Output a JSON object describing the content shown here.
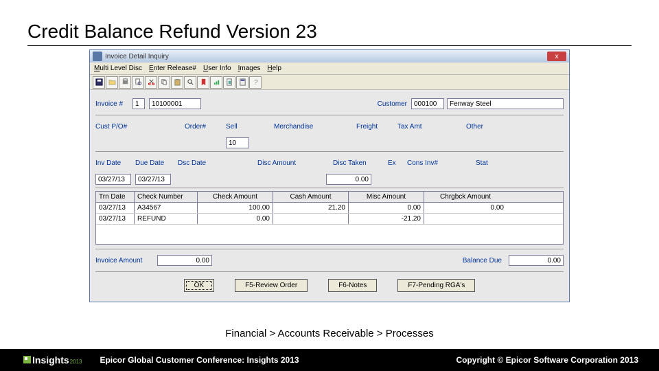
{
  "slide": {
    "title": "Credit Balance Refund Version 23"
  },
  "window": {
    "title": "Invoice Detail Inquiry",
    "close": "x"
  },
  "menu": [
    "Multi Level Disc",
    "Enter Release#",
    "User Info",
    "Images",
    "Help"
  ],
  "row1": {
    "invoice_lbl": "Invoice #",
    "seq": "1",
    "invoice": "10100001",
    "customer_lbl": "Customer",
    "customer_id": "000100",
    "customer_name": "Fenway Steel"
  },
  "row2": {
    "custpo_lbl": "Cust P/O#",
    "order_lbl": "Order#",
    "sell_lbl": "Sell",
    "merch_lbl": "Merchandise",
    "freight_lbl": "Freight",
    "tax_lbl": "Tax Amt",
    "other_lbl": "Other",
    "sell_val": "10"
  },
  "row3": {
    "invdate_lbl": "Inv Date",
    "duedate_lbl": "Due Date",
    "dscdate_lbl": "Dsc Date",
    "discamt_lbl": "Disc Amount",
    "disctaken_lbl": "Disc Taken",
    "ex_lbl": "Ex",
    "consinv_lbl": "Cons Inv#",
    "stat_lbl": "Stat",
    "invdate": "03/27/13",
    "duedate": "03/27/13",
    "disctaken": "0.00"
  },
  "table": {
    "headers": [
      "Trn Date",
      "Check Number",
      "Check Amount",
      "Cash Amount",
      "Misc Amount",
      "Chrgbck Amount"
    ],
    "rows": [
      {
        "date": "03/27/13",
        "chk": "A34567",
        "chkamt": "100.00",
        "cash": "21.20",
        "misc": "0.00",
        "cb": "0.00"
      },
      {
        "date": "03/27/13",
        "chk": "REFUND",
        "chkamt": "0.00",
        "cash": "",
        "misc": "-21.20",
        "cb": ""
      }
    ]
  },
  "totals": {
    "invamt_lbl": "Invoice Amount",
    "invamt": "0.00",
    "baldue_lbl": "Balance Due",
    "baldue": "0.00"
  },
  "buttons": {
    "ok": "OK",
    "f5": "F5-Review Order",
    "f6": "F6-Notes",
    "f7": "F7-Pending RGA's"
  },
  "breadcrumb": "Financial > Accounts Receivable > Processes",
  "footer": {
    "logo": "Insights",
    "year": "2013",
    "mid": "Epicor Global Customer Conference: Insights 2013",
    "right": "Copyright © Epicor Software Corporation 2013"
  }
}
